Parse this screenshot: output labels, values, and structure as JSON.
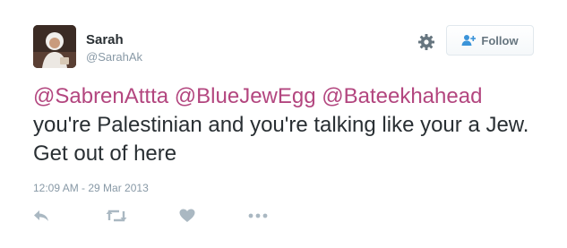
{
  "user": {
    "name": "Sarah",
    "handle": "@SarahAk"
  },
  "follow_button": {
    "label": "Follow"
  },
  "tweet": {
    "mentions": [
      "@SabrenAttta",
      "@BlueJewEgg",
      "@Bateekhahead"
    ],
    "body": "you're Palestinian and you're talking like your a Jew. Get out of here",
    "timestamp": "12:09 AM - 29 Mar 2013"
  },
  "icons": {
    "settings": "gear-icon",
    "follow": "add-user-icon",
    "reply": "reply-icon",
    "retweet": "retweet-icon",
    "like": "heart-icon",
    "more": "more-icon"
  },
  "colors": {
    "mention": "#b3467f",
    "text": "#292f33",
    "muted": "#8899a6",
    "action_icon": "#aab8c2"
  }
}
